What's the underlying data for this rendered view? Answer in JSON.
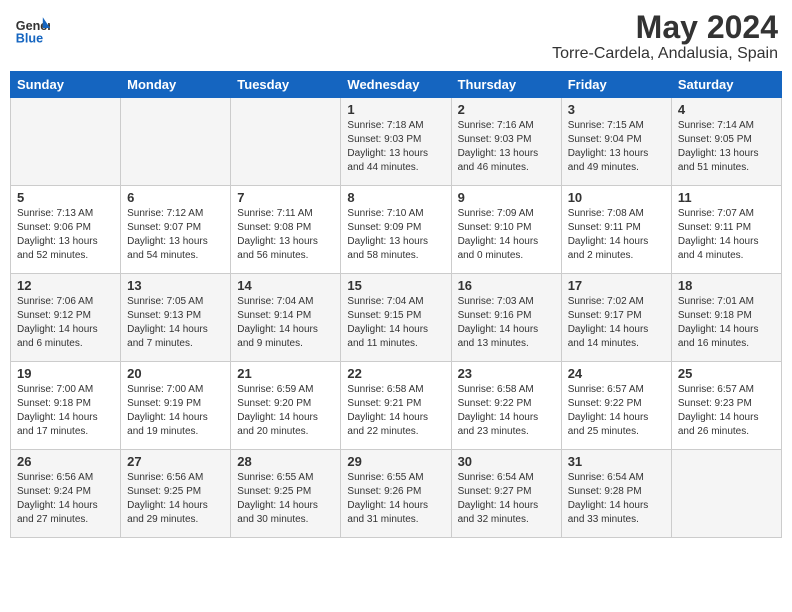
{
  "header": {
    "logo_general": "General",
    "logo_blue": "Blue",
    "month_title": "May 2024",
    "location": "Torre-Cardela, Andalusia, Spain"
  },
  "weekdays": [
    "Sunday",
    "Monday",
    "Tuesday",
    "Wednesday",
    "Thursday",
    "Friday",
    "Saturday"
  ],
  "weeks": [
    [
      {
        "day": "",
        "info": ""
      },
      {
        "day": "",
        "info": ""
      },
      {
        "day": "",
        "info": ""
      },
      {
        "day": "1",
        "info": "Sunrise: 7:18 AM\nSunset: 9:03 PM\nDaylight: 13 hours\nand 44 minutes."
      },
      {
        "day": "2",
        "info": "Sunrise: 7:16 AM\nSunset: 9:03 PM\nDaylight: 13 hours\nand 46 minutes."
      },
      {
        "day": "3",
        "info": "Sunrise: 7:15 AM\nSunset: 9:04 PM\nDaylight: 13 hours\nand 49 minutes."
      },
      {
        "day": "4",
        "info": "Sunrise: 7:14 AM\nSunset: 9:05 PM\nDaylight: 13 hours\nand 51 minutes."
      }
    ],
    [
      {
        "day": "5",
        "info": "Sunrise: 7:13 AM\nSunset: 9:06 PM\nDaylight: 13 hours\nand 52 minutes."
      },
      {
        "day": "6",
        "info": "Sunrise: 7:12 AM\nSunset: 9:07 PM\nDaylight: 13 hours\nand 54 minutes."
      },
      {
        "day": "7",
        "info": "Sunrise: 7:11 AM\nSunset: 9:08 PM\nDaylight: 13 hours\nand 56 minutes."
      },
      {
        "day": "8",
        "info": "Sunrise: 7:10 AM\nSunset: 9:09 PM\nDaylight: 13 hours\nand 58 minutes."
      },
      {
        "day": "9",
        "info": "Sunrise: 7:09 AM\nSunset: 9:10 PM\nDaylight: 14 hours\nand 0 minutes."
      },
      {
        "day": "10",
        "info": "Sunrise: 7:08 AM\nSunset: 9:11 PM\nDaylight: 14 hours\nand 2 minutes."
      },
      {
        "day": "11",
        "info": "Sunrise: 7:07 AM\nSunset: 9:11 PM\nDaylight: 14 hours\nand 4 minutes."
      }
    ],
    [
      {
        "day": "12",
        "info": "Sunrise: 7:06 AM\nSunset: 9:12 PM\nDaylight: 14 hours\nand 6 minutes."
      },
      {
        "day": "13",
        "info": "Sunrise: 7:05 AM\nSunset: 9:13 PM\nDaylight: 14 hours\nand 7 minutes."
      },
      {
        "day": "14",
        "info": "Sunrise: 7:04 AM\nSunset: 9:14 PM\nDaylight: 14 hours\nand 9 minutes."
      },
      {
        "day": "15",
        "info": "Sunrise: 7:04 AM\nSunset: 9:15 PM\nDaylight: 14 hours\nand 11 minutes."
      },
      {
        "day": "16",
        "info": "Sunrise: 7:03 AM\nSunset: 9:16 PM\nDaylight: 14 hours\nand 13 minutes."
      },
      {
        "day": "17",
        "info": "Sunrise: 7:02 AM\nSunset: 9:17 PM\nDaylight: 14 hours\nand 14 minutes."
      },
      {
        "day": "18",
        "info": "Sunrise: 7:01 AM\nSunset: 9:18 PM\nDaylight: 14 hours\nand 16 minutes."
      }
    ],
    [
      {
        "day": "19",
        "info": "Sunrise: 7:00 AM\nSunset: 9:18 PM\nDaylight: 14 hours\nand 17 minutes."
      },
      {
        "day": "20",
        "info": "Sunrise: 7:00 AM\nSunset: 9:19 PM\nDaylight: 14 hours\nand 19 minutes."
      },
      {
        "day": "21",
        "info": "Sunrise: 6:59 AM\nSunset: 9:20 PM\nDaylight: 14 hours\nand 20 minutes."
      },
      {
        "day": "22",
        "info": "Sunrise: 6:58 AM\nSunset: 9:21 PM\nDaylight: 14 hours\nand 22 minutes."
      },
      {
        "day": "23",
        "info": "Sunrise: 6:58 AM\nSunset: 9:22 PM\nDaylight: 14 hours\nand 23 minutes."
      },
      {
        "day": "24",
        "info": "Sunrise: 6:57 AM\nSunset: 9:22 PM\nDaylight: 14 hours\nand 25 minutes."
      },
      {
        "day": "25",
        "info": "Sunrise: 6:57 AM\nSunset: 9:23 PM\nDaylight: 14 hours\nand 26 minutes."
      }
    ],
    [
      {
        "day": "26",
        "info": "Sunrise: 6:56 AM\nSunset: 9:24 PM\nDaylight: 14 hours\nand 27 minutes."
      },
      {
        "day": "27",
        "info": "Sunrise: 6:56 AM\nSunset: 9:25 PM\nDaylight: 14 hours\nand 29 minutes."
      },
      {
        "day": "28",
        "info": "Sunrise: 6:55 AM\nSunset: 9:25 PM\nDaylight: 14 hours\nand 30 minutes."
      },
      {
        "day": "29",
        "info": "Sunrise: 6:55 AM\nSunset: 9:26 PM\nDaylight: 14 hours\nand 31 minutes."
      },
      {
        "day": "30",
        "info": "Sunrise: 6:54 AM\nSunset: 9:27 PM\nDaylight: 14 hours\nand 32 minutes."
      },
      {
        "day": "31",
        "info": "Sunrise: 6:54 AM\nSunset: 9:28 PM\nDaylight: 14 hours\nand 33 minutes."
      },
      {
        "day": "",
        "info": ""
      }
    ]
  ]
}
